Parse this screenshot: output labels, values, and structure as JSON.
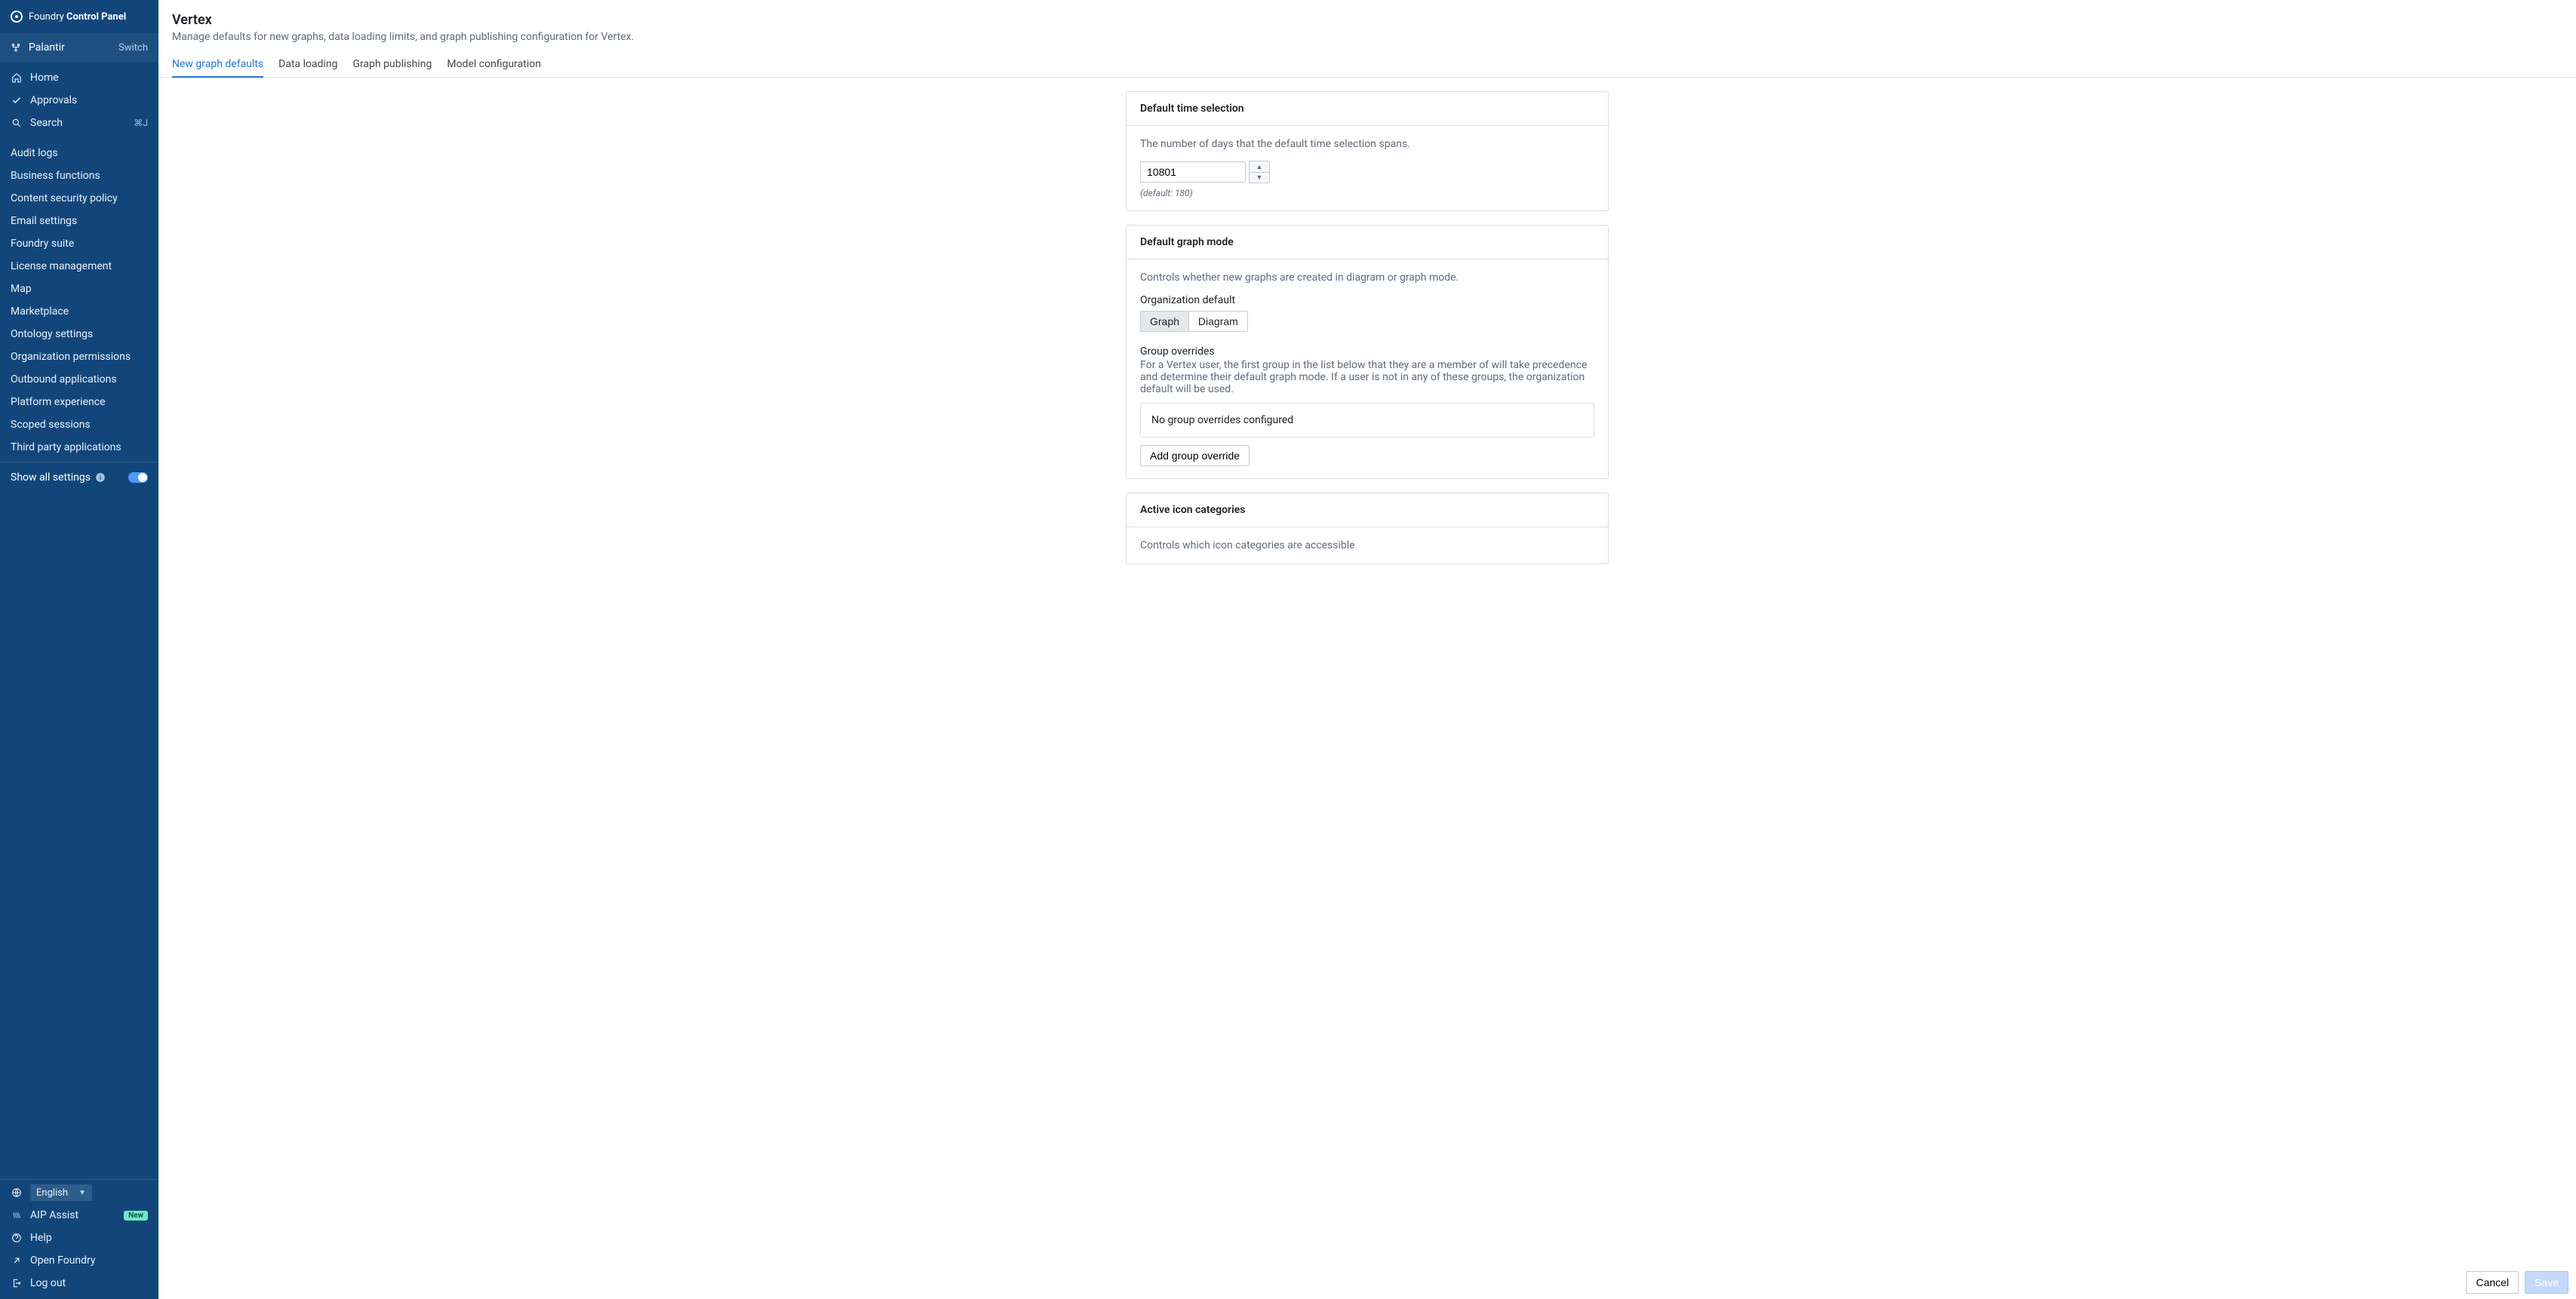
{
  "app": {
    "name_prefix": "Foundry ",
    "name_bold": "Control Panel"
  },
  "org": {
    "name": "Palantir",
    "switch": "Switch"
  },
  "nav": {
    "home": "Home",
    "approvals": "Approvals",
    "search": "Search",
    "search_shortcut": "⌘J"
  },
  "subnav": [
    "Audit logs",
    "Business functions",
    "Content security policy",
    "Email settings",
    "Foundry suite",
    "License management",
    "Map",
    "Marketplace",
    "Ontology settings",
    "Organization permissions",
    "Outbound applications",
    "Platform experience",
    "Scoped sessions",
    "Third party applications"
  ],
  "show_all": "Show all settings",
  "footer": {
    "language": "English",
    "aip": "AIP Assist",
    "aip_badge": "New",
    "help": "Help",
    "open_foundry": "Open Foundry",
    "log_out": "Log out"
  },
  "page": {
    "title": "Vertex",
    "subtitle": "Manage defaults for new graphs, data loading limits, and graph publishing configuration for Vertex."
  },
  "tabs": [
    "New graph defaults",
    "Data loading",
    "Graph publishing",
    "Model configuration"
  ],
  "card_time": {
    "title": "Default time selection",
    "desc": "The number of days that the default time selection spans.",
    "value": "10801",
    "hint": "(default: 180)"
  },
  "card_mode": {
    "title": "Default graph mode",
    "desc": "Controls whether new graphs are created in diagram or graph mode.",
    "org_default_label": "Organization default",
    "seg": [
      "Graph",
      "Diagram"
    ],
    "overrides_label": "Group overrides",
    "overrides_desc": "For a Vertex user, the first group in the list below that they are a member of will take precedence and determine their default graph mode. If a user is not in any of these groups, the organization default will be used.",
    "overrides_empty": "No group overrides configured",
    "add_override": "Add group override"
  },
  "card_icons": {
    "title": "Active icon categories",
    "desc": "Controls which icon categories are accessible"
  },
  "actions": {
    "cancel": "Cancel",
    "save": "Save"
  }
}
